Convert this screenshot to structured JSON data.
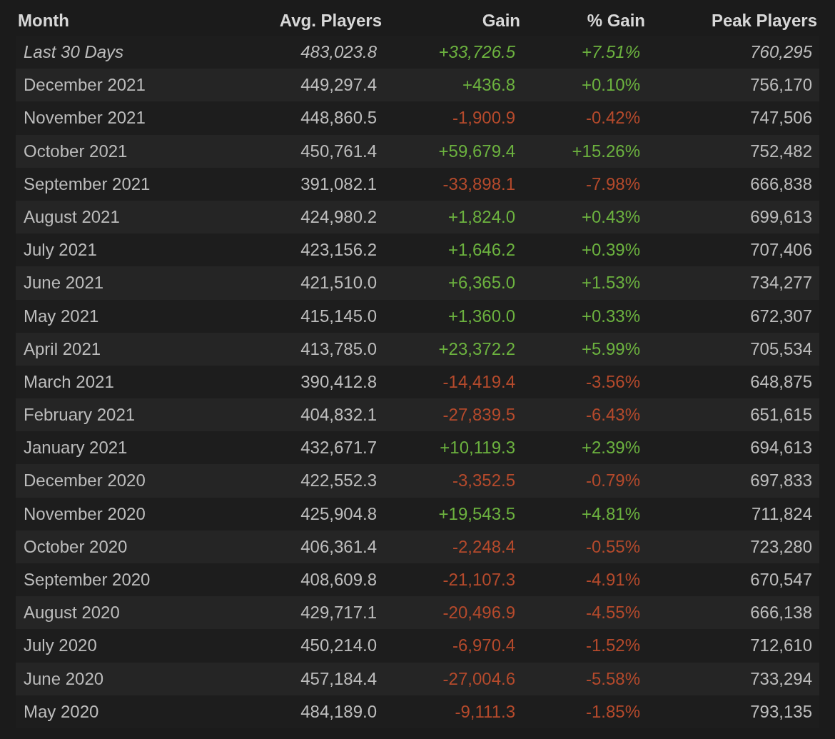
{
  "columns": [
    "Month",
    "Avg. Players",
    "Gain",
    "% Gain",
    "Peak Players"
  ],
  "rows": [
    {
      "month": "Last 30 Days",
      "avg": "483,023.8",
      "gain": "+33,726.5",
      "pct": "+7.51%",
      "peak": "760,295",
      "kind": "gain",
      "current": true
    },
    {
      "month": "December 2021",
      "avg": "449,297.4",
      "gain": "+436.8",
      "pct": "+0.10%",
      "peak": "756,170",
      "kind": "gain",
      "current": false
    },
    {
      "month": "November 2021",
      "avg": "448,860.5",
      "gain": "-1,900.9",
      "pct": "-0.42%",
      "peak": "747,506",
      "kind": "loss",
      "current": false
    },
    {
      "month": "October 2021",
      "avg": "450,761.4",
      "gain": "+59,679.4",
      "pct": "+15.26%",
      "peak": "752,482",
      "kind": "gain",
      "current": false
    },
    {
      "month": "September 2021",
      "avg": "391,082.1",
      "gain": "-33,898.1",
      "pct": "-7.98%",
      "peak": "666,838",
      "kind": "loss",
      "current": false
    },
    {
      "month": "August 2021",
      "avg": "424,980.2",
      "gain": "+1,824.0",
      "pct": "+0.43%",
      "peak": "699,613",
      "kind": "gain",
      "current": false
    },
    {
      "month": "July 2021",
      "avg": "423,156.2",
      "gain": "+1,646.2",
      "pct": "+0.39%",
      "peak": "707,406",
      "kind": "gain",
      "current": false
    },
    {
      "month": "June 2021",
      "avg": "421,510.0",
      "gain": "+6,365.0",
      "pct": "+1.53%",
      "peak": "734,277",
      "kind": "gain",
      "current": false
    },
    {
      "month": "May 2021",
      "avg": "415,145.0",
      "gain": "+1,360.0",
      "pct": "+0.33%",
      "peak": "672,307",
      "kind": "gain",
      "current": false
    },
    {
      "month": "April 2021",
      "avg": "413,785.0",
      "gain": "+23,372.2",
      "pct": "+5.99%",
      "peak": "705,534",
      "kind": "gain",
      "current": false
    },
    {
      "month": "March 2021",
      "avg": "390,412.8",
      "gain": "-14,419.4",
      "pct": "-3.56%",
      "peak": "648,875",
      "kind": "loss",
      "current": false
    },
    {
      "month": "February 2021",
      "avg": "404,832.1",
      "gain": "-27,839.5",
      "pct": "-6.43%",
      "peak": "651,615",
      "kind": "loss",
      "current": false
    },
    {
      "month": "January 2021",
      "avg": "432,671.7",
      "gain": "+10,119.3",
      "pct": "+2.39%",
      "peak": "694,613",
      "kind": "gain",
      "current": false
    },
    {
      "month": "December 2020",
      "avg": "422,552.3",
      "gain": "-3,352.5",
      "pct": "-0.79%",
      "peak": "697,833",
      "kind": "loss",
      "current": false
    },
    {
      "month": "November 2020",
      "avg": "425,904.8",
      "gain": "+19,543.5",
      "pct": "+4.81%",
      "peak": "711,824",
      "kind": "gain",
      "current": false
    },
    {
      "month": "October 2020",
      "avg": "406,361.4",
      "gain": "-2,248.4",
      "pct": "-0.55%",
      "peak": "723,280",
      "kind": "loss",
      "current": false
    },
    {
      "month": "September 2020",
      "avg": "408,609.8",
      "gain": "-21,107.3",
      "pct": "-4.91%",
      "peak": "670,547",
      "kind": "loss",
      "current": false
    },
    {
      "month": "August 2020",
      "avg": "429,717.1",
      "gain": "-20,496.9",
      "pct": "-4.55%",
      "peak": "666,138",
      "kind": "loss",
      "current": false
    },
    {
      "month": "July 2020",
      "avg": "450,214.0",
      "gain": "-6,970.4",
      "pct": "-1.52%",
      "peak": "712,610",
      "kind": "loss",
      "current": false
    },
    {
      "month": "June 2020",
      "avg": "457,184.4",
      "gain": "-27,004.6",
      "pct": "-5.58%",
      "peak": "733,294",
      "kind": "loss",
      "current": false
    },
    {
      "month": "May 2020",
      "avg": "484,189.0",
      "gain": "-9,111.3",
      "pct": "-1.85%",
      "peak": "793,135",
      "kind": "loss",
      "current": false
    }
  ]
}
